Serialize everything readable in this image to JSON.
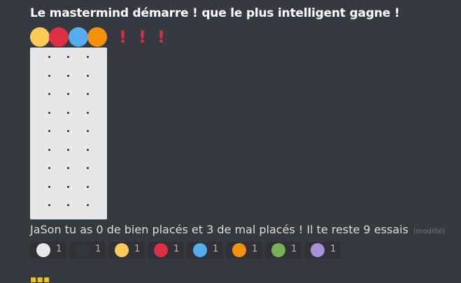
{
  "message": {
    "title": "Le mastermind démarre ! que le plus intelligent gagne !",
    "status_text": "JaSon tu as 0 de bien placés et 3 de mal placés ! Il te reste 9 essais",
    "edited_label": "(modifié)"
  },
  "pegs": [
    {
      "color": "#fdcb58",
      "icon": "yellow-circle"
    },
    {
      "color": "#dd2e44",
      "icon": "red-circle"
    },
    {
      "color": "#55acee",
      "icon": "blue-circle"
    },
    {
      "color": "#f4900c",
      "icon": "orange-circle"
    }
  ],
  "exclamations": [
    "!",
    "!",
    "!"
  ],
  "board": {
    "rows": 9,
    "cols": 3,
    "color": "#e6e7e8"
  },
  "reactions": [
    {
      "color": "#e6e7e8",
      "icon": "white-circle",
      "count": "1"
    },
    {
      "color": "#31373d",
      "icon": "black-circle",
      "count": "1"
    },
    {
      "color": "#fdcb58",
      "icon": "yellow-circle",
      "count": "1"
    },
    {
      "color": "#dd2e44",
      "icon": "red-circle",
      "count": "1"
    },
    {
      "color": "#55acee",
      "icon": "blue-circle",
      "count": "1"
    },
    {
      "color": "#f4900c",
      "icon": "orange-circle",
      "count": "1"
    },
    {
      "color": "#78b159",
      "icon": "green-circle",
      "count": "1"
    },
    {
      "color": "#aa8ed6",
      "icon": "purple-circle",
      "count": "1"
    }
  ]
}
